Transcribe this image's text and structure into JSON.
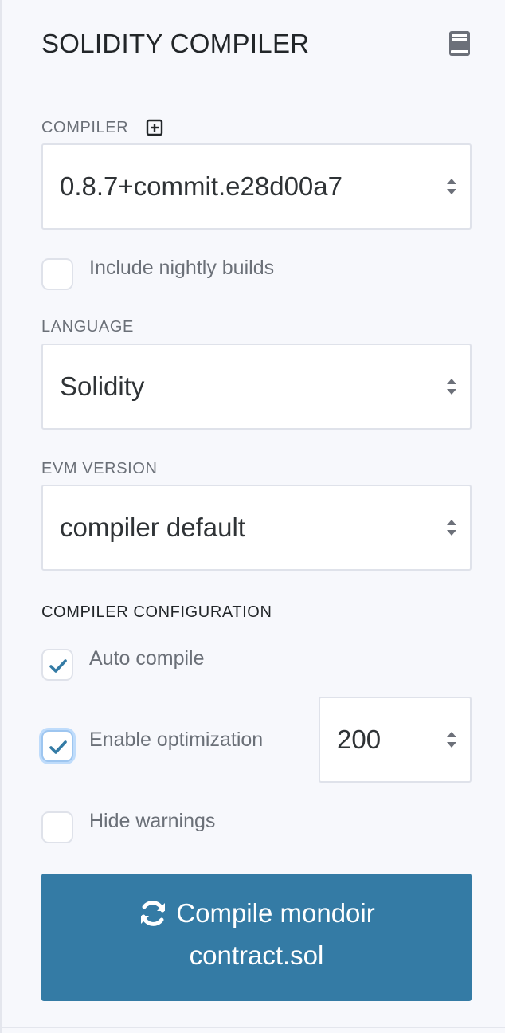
{
  "header": {
    "title": "SOLIDITY COMPILER",
    "doc_icon": "book-icon"
  },
  "compiler": {
    "label": "COMPILER",
    "add_icon": "plus-square-icon",
    "selected_version": "0.8.7+commit.e28d00a7",
    "nightly_label": "Include nightly builds",
    "nightly_checked": false
  },
  "language": {
    "label": "LANGUAGE",
    "selected": "Solidity"
  },
  "evm": {
    "label": "EVM VERSION",
    "selected": "compiler default"
  },
  "configuration": {
    "label": "COMPILER CONFIGURATION",
    "auto_compile_label": "Auto compile",
    "auto_compile_checked": true,
    "optimization_label": "Enable optimization",
    "optimization_checked": true,
    "optimization_runs": "200",
    "hide_warnings_label": "Hide warnings",
    "hide_warnings_checked": false
  },
  "compile_button": {
    "icon": "refresh-icon",
    "line1": "Compile mondoir",
    "line2": "contract.sol"
  },
  "colors": {
    "button_bg": "#347ba5",
    "check_color": "#347ba5",
    "background": "#f7f8fc"
  }
}
